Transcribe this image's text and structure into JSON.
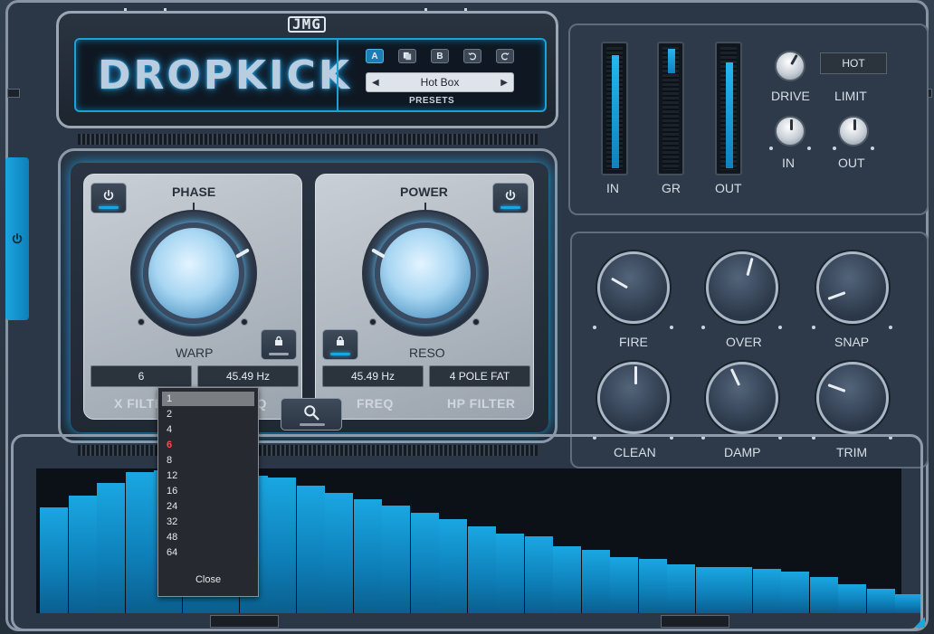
{
  "plugin": {
    "title": "DROPKICK",
    "brand": "JMG"
  },
  "header": {
    "buttons": [
      {
        "label": "A",
        "icon": "letter-a",
        "active": true
      },
      {
        "label": "",
        "icon": "copy-icon"
      },
      {
        "label": "B",
        "icon": "letter-b"
      },
      {
        "label": "",
        "icon": "undo-icon"
      },
      {
        "label": "",
        "icon": "redo-icon"
      }
    ],
    "preset_name": "Hot Box",
    "presets_label": "PRESETS"
  },
  "filter": {
    "phase_label": "PHASE",
    "power_label": "POWER",
    "warp_label": "WARP",
    "reso_label": "RESO",
    "x_filter_value": "6",
    "x_filter_freq": "45.49 Hz",
    "hp_freq": "45.49 Hz",
    "hp_type": "4 POLE FAT",
    "x_filter_label": "X FILTER",
    "freq_label_left": "FREQ",
    "freq_label_right": "FREQ",
    "hp_filter_label": "HP FILTER"
  },
  "meters": {
    "in_label": "IN",
    "gr_label": "GR",
    "out_label": "OUT",
    "in_level": 0.92,
    "gr_level": 0.2,
    "out_level": 0.86
  },
  "dynamics": {
    "mode_display": "HOT",
    "drive_label": "DRIVE",
    "limit_label": "LIMIT",
    "in_label": "IN",
    "out_label": "OUT"
  },
  "character": {
    "knobs": [
      {
        "label": "FIRE",
        "value": 0.3
      },
      {
        "label": "OVER",
        "value": 0.55
      },
      {
        "label": "SNAP",
        "value": 0.25
      },
      {
        "label": "CLEAN",
        "value": 0.5
      },
      {
        "label": "DAMP",
        "value": 0.4
      },
      {
        "label": "TRIM",
        "value": 0.35
      }
    ]
  },
  "analyzer": {
    "levels": [
      0.74,
      0.82,
      0.91,
      0.99,
      1.0,
      0.99,
      0.97,
      0.96,
      0.95,
      0.89,
      0.84,
      0.8,
      0.75,
      0.7,
      0.66,
      0.61,
      0.56,
      0.54,
      0.47,
      0.44,
      0.39,
      0.38,
      0.34,
      0.32,
      0.32,
      0.31,
      0.29,
      0.25,
      0.2,
      0.17,
      0.13
    ]
  },
  "dropdown": {
    "options": [
      "1",
      "2",
      "4",
      "6",
      "8",
      "12",
      "16",
      "24",
      "32",
      "48",
      "64"
    ],
    "highlighted_index": 0,
    "current_index": 3,
    "close_label": "Close"
  },
  "colors": {
    "accent": "#1aa6e0",
    "current_option": "#ff4a4a"
  }
}
